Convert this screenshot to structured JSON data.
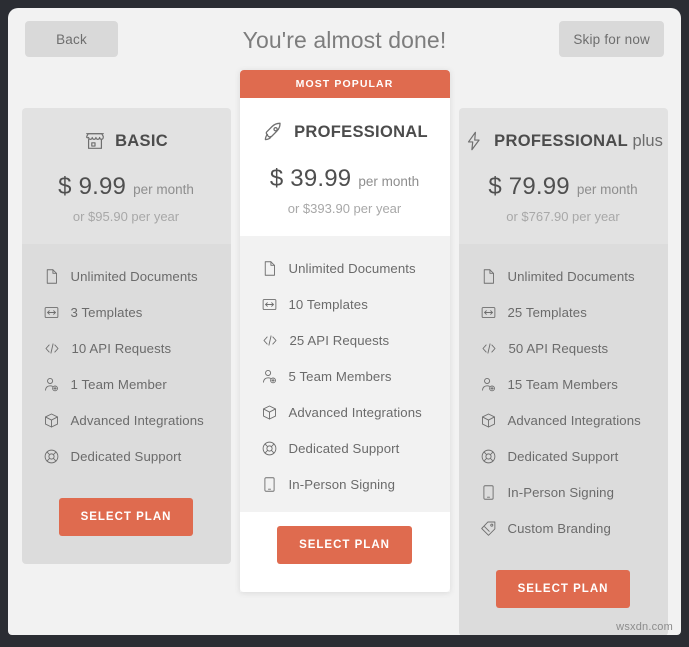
{
  "header": {
    "back_label": "Back",
    "title": "You're almost done!",
    "skip_label": "Skip for now"
  },
  "colors": {
    "accent": "#df6b4f",
    "frame": "#2b2d33",
    "page_bg": "#f2f2f2",
    "card_bg": "#dcdcdc",
    "card_head_bg": "#e2e2e2",
    "featured_bg": "#ffffff",
    "text": "#6b6b6b"
  },
  "select_label": "SELECT PLAN",
  "badge_label": "MOST POPULAR",
  "plans": [
    {
      "id": "basic",
      "icon": "shop-icon",
      "name": "BASIC",
      "name_suffix": "",
      "currency": "$",
      "price": "9.99",
      "period": "per month",
      "yearly": "or $95.90 per year",
      "featured": false,
      "features": [
        {
          "icon": "document-icon",
          "label": "Unlimited Documents"
        },
        {
          "icon": "template-icon",
          "label": "3 Templates"
        },
        {
          "icon": "code-icon",
          "label": "10 API Requests"
        },
        {
          "icon": "team-member-icon",
          "label": "1 Team Member"
        },
        {
          "icon": "cube-icon",
          "label": "Advanced Integrations"
        },
        {
          "icon": "lifebuoy-icon",
          "label": "Dedicated Support"
        }
      ]
    },
    {
      "id": "professional",
      "icon": "rocket-icon",
      "name": "PROFESSIONAL",
      "name_suffix": "",
      "currency": "$",
      "price": "39.99",
      "period": "per month",
      "yearly": "or $393.90 per year",
      "featured": true,
      "features": [
        {
          "icon": "document-icon",
          "label": "Unlimited Documents"
        },
        {
          "icon": "template-icon",
          "label": "10 Templates"
        },
        {
          "icon": "code-icon",
          "label": "25 API Requests"
        },
        {
          "icon": "team-member-icon",
          "label": "5 Team Members"
        },
        {
          "icon": "cube-icon",
          "label": "Advanced Integrations"
        },
        {
          "icon": "lifebuoy-icon",
          "label": "Dedicated Support"
        },
        {
          "icon": "tablet-icon",
          "label": "In-Person Signing"
        }
      ]
    },
    {
      "id": "professional-plus",
      "icon": "bolt-icon",
      "name": "PROFESSIONAL",
      "name_suffix": "plus",
      "currency": "$",
      "price": "79.99",
      "period": "per month",
      "yearly": "or $767.90 per year",
      "featured": false,
      "features": [
        {
          "icon": "document-icon",
          "label": "Unlimited Documents"
        },
        {
          "icon": "template-icon",
          "label": "25 Templates"
        },
        {
          "icon": "code-icon",
          "label": "50 API Requests"
        },
        {
          "icon": "team-member-icon",
          "label": "15 Team Members"
        },
        {
          "icon": "cube-icon",
          "label": "Advanced Integrations"
        },
        {
          "icon": "lifebuoy-icon",
          "label": "Dedicated Support"
        },
        {
          "icon": "tablet-icon",
          "label": "In-Person Signing"
        },
        {
          "icon": "tag-icon",
          "label": "Custom Branding"
        }
      ]
    }
  ],
  "watermark": "wsxdn.com"
}
